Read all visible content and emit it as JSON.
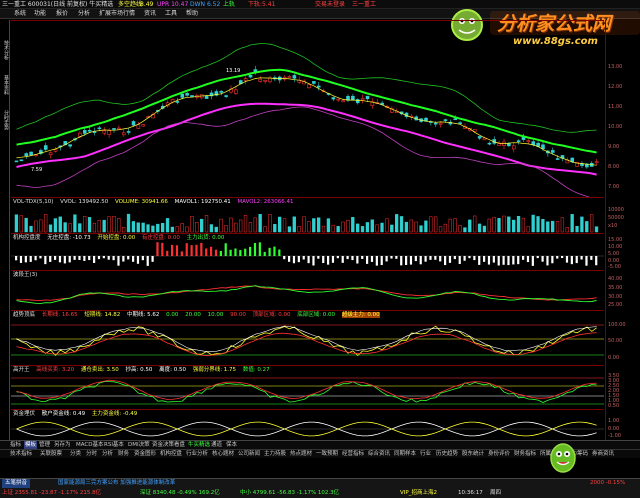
{
  "titlebar": {
    "stock_info": "三一重工 600031(日线 前复权) 牛买精选",
    "indicator_label": "多空趋线",
    "indicator_value": "8.49",
    "upr": "UPR 10.47",
    "dwn": "DWN 6.52",
    "up_text": "上轨",
    "down_text": "下轨:5.41",
    "link1": "交易未登录",
    "link2": "三一重工"
  },
  "menu": [
    "系统",
    "功能",
    "报价",
    "分析",
    "扩展市场行情",
    "资讯",
    "工具",
    "帮助"
  ],
  "sidebar": [
    "技术分析",
    "基本资料",
    "分时走势"
  ],
  "main_chart": {
    "annotation_high": "13.19",
    "annotation_low": "7.59",
    "y_labels": [
      "13.00",
      "12.00",
      "11.00",
      "10.00",
      "9.00",
      "8.00",
      "7.00"
    ]
  },
  "volume_panel": {
    "header": [
      "VOL-TDX(5,10)",
      "VVOL: 139492.50",
      "VOLUME: 30941.66",
      "MAVOL1: 192750.41",
      "MAVOL2: 263066.41"
    ],
    "y_labels": [
      "10000",
      "50000",
      "x10"
    ]
  },
  "capital_panel": {
    "header": [
      "机构控盘度",
      "无庄控盘: -10.73",
      "开始控盘: 0.00",
      "有庄控盘: 0.00",
      "主力出货: 0.00"
    ],
    "y_labels": [
      "15.00",
      "10.00",
      "5.00",
      "0.00",
      "-5.00"
    ]
  },
  "wave_panel": {
    "header": [
      "波段王(3)"
    ],
    "y_labels": [
      "40.00",
      "35.00",
      "30.00",
      "25.00"
    ]
  },
  "trend_panel": {
    "header": [
      "趋势顶底",
      "长期线: 16.65",
      "短期线: 14.82",
      "中期线: 5.62",
      "0.00",
      "20.00",
      "10.00",
      "90.00",
      "顶部区域: 0.00",
      "底部区域: 0.00",
      "超级主力: 0.00"
    ],
    "y_labels": [
      "100.00",
      "50.00",
      "0.00"
    ]
  },
  "swing_panel": {
    "header": [
      "高开王",
      "高线买卖: 3.20",
      "通仓卖出: 3.50",
      "抄高: 0.50",
      "离度: 0.50",
      "强弱分界线: 1.75",
      "数值: 0.27"
    ],
    "y_labels": [
      "3.50",
      "3.00",
      "2.50",
      "2.00",
      "1.50",
      "1.00",
      "0.50"
    ]
  },
  "fund_panel": {
    "header": [
      "资金埋伏",
      "散户资金线: 0.49",
      "主力资金线: -0.49"
    ],
    "y_labels": [
      "1.00",
      "0.00",
      "-1.00"
    ]
  },
  "tabs": [
    "指标",
    "模板",
    "管理",
    "另存为",
    "MACD基本",
    "RSI基本",
    "DMI决策",
    "资金决策",
    "看盘",
    "牛买精选",
    "通道",
    "保本",
    "技术指标",
    "关联股票",
    "分类",
    "分时",
    "分析",
    "财务",
    "资金图形",
    "机构控盘",
    "行业分析",
    "核心题材",
    "公司新闻",
    "主力持股",
    "热点题材",
    "一致预期",
    "经营指标",
    "综合资讯",
    "同期样本",
    "行业",
    "历史趋势",
    "股东统计",
    "身份评价",
    "财务指标",
    "所属板块",
    "主力筹码",
    "券商资讯"
  ],
  "status": {
    "menu_button": "五笔拼音",
    "market1": "上证 2355.81 -23.87 -1.17% 215.8亿",
    "market2": "深证 8340.48 -0.49% 169.2亿",
    "market3": "中小 4799.61 -56.83 -1.17% 102.3亿",
    "notice": "国家能源局三完方案公布 加强推进能源体制改革",
    "right1": "VIP_招商上海2",
    "time": "10:36:17",
    "weekday": "周四",
    "stock_tick": "2000 -0.15%"
  },
  "logo": {
    "title": "分析家公式网",
    "url": "www.88gs.com"
  },
  "colors": {
    "up": "#ff3030",
    "down": "#30d0d0",
    "ma_green": "#20ff20",
    "ma_magenta": "#ff30ff",
    "ma_yellow": "#ffff30",
    "axis_red": "#b00000"
  }
}
